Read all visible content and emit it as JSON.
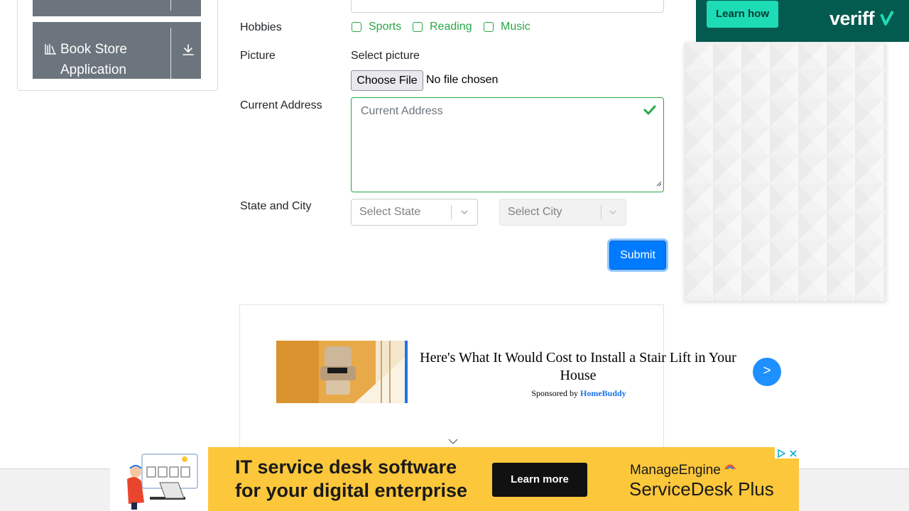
{
  "sidebar": {
    "items": [
      {
        "label": ""
      },
      {
        "label": "Book Store Application"
      }
    ]
  },
  "form": {
    "hobbies_label": "Hobbies",
    "hobbies": [
      "Sports",
      "Reading",
      "Music"
    ],
    "picture_label": "Picture",
    "picture_hint": "Select picture",
    "choose_file_label": "Choose File",
    "file_status": "No file chosen",
    "address_label": "Current Address",
    "address_placeholder": "Current Address",
    "state_city_label": "State and City",
    "state_placeholder": "Select State",
    "city_placeholder": "Select City",
    "submit_label": "Submit"
  },
  "native_ad": {
    "headline": "Here's What It Would Cost to Install a Stair Lift in Your House",
    "sponsored_prefix": "Sponsored by",
    "sponsor": "HomeBuddy",
    "next_label": ">"
  },
  "side_ad": {
    "button_label": "Learn how",
    "brand": "veriff"
  },
  "banner_ad": {
    "headline_line1": "IT service desk software",
    "headline_line2": "for your digital enterprise",
    "cta_label": "Learn more",
    "brand_line1": "ManageEngine",
    "brand_line2": "ServiceDesk Plus"
  },
  "colors": {
    "success": "#28a745",
    "primary": "#007bff",
    "sidebar_item": "#6c757d",
    "veriff_bg": "#035a4e",
    "veriff_accent": "#1ddbb5",
    "banner_bg": "#fcc73b"
  }
}
